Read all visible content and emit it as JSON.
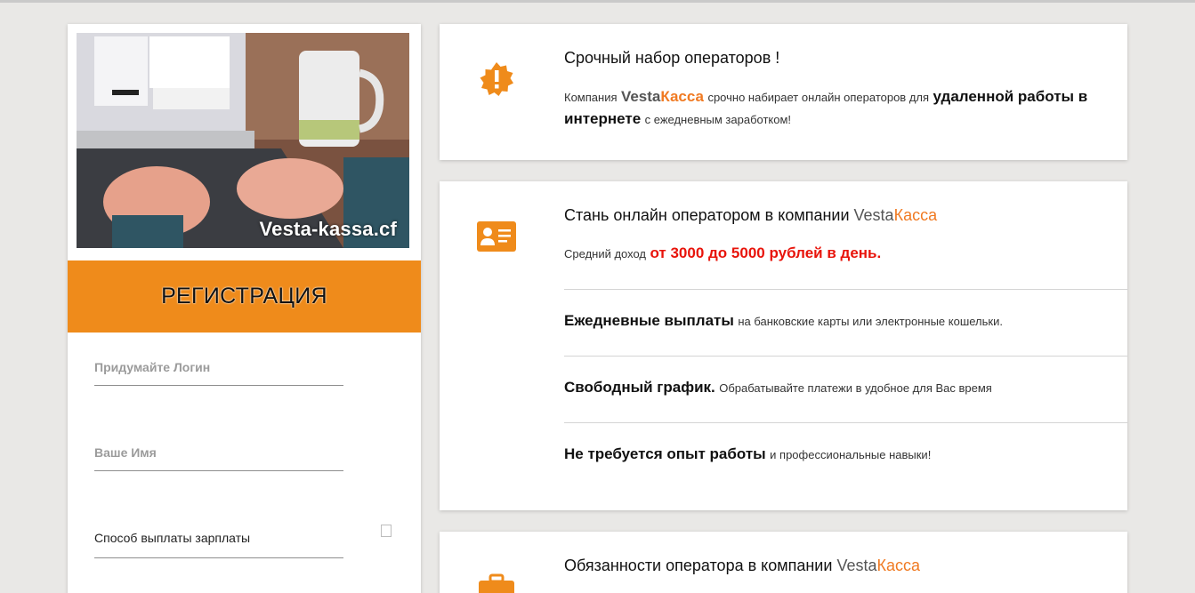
{
  "left": {
    "photo_caption": "Vesta-kassa.cf",
    "registration_title": "РЕГИСТРАЦИЯ",
    "login_placeholder": "Придумайте Логин",
    "name_placeholder": "Ваше Имя",
    "payout_label": "Способ выплаты зарплаты"
  },
  "brand": {
    "part1": "Vesta",
    "part2": "Касса"
  },
  "card1": {
    "icon": "alert-badge-icon",
    "title": "Срочный набор операторов !",
    "t1": "Компания",
    "t2": "срочно набирает онлайн операторов для",
    "t3": "удаленной работы в интернете",
    "t4": "с ежедневным заработком!"
  },
  "card2": {
    "icon": "id-card-icon",
    "title": "Стань онлайн оператором в компании",
    "income_label": "Средний доход",
    "income_value": "от 3000 до 5000 рублей в день.",
    "features": [
      {
        "bold": "Ежедневные выплаты",
        "text": "на банковские карты или электронные кошельки."
      },
      {
        "bold": "Свободный график.",
        "text": "Обрабатывайте платежи в удобное для Вас время"
      },
      {
        "bold": "Не требуется опыт работы",
        "text": "и профессиональные навыки!"
      }
    ]
  },
  "card3": {
    "icon": "briefcase-icon",
    "title": "Обязанности оператора в компании"
  },
  "colors": {
    "accent": "#ef8b1b",
    "brand_orange": "#f07a22",
    "red": "#e8140b"
  }
}
